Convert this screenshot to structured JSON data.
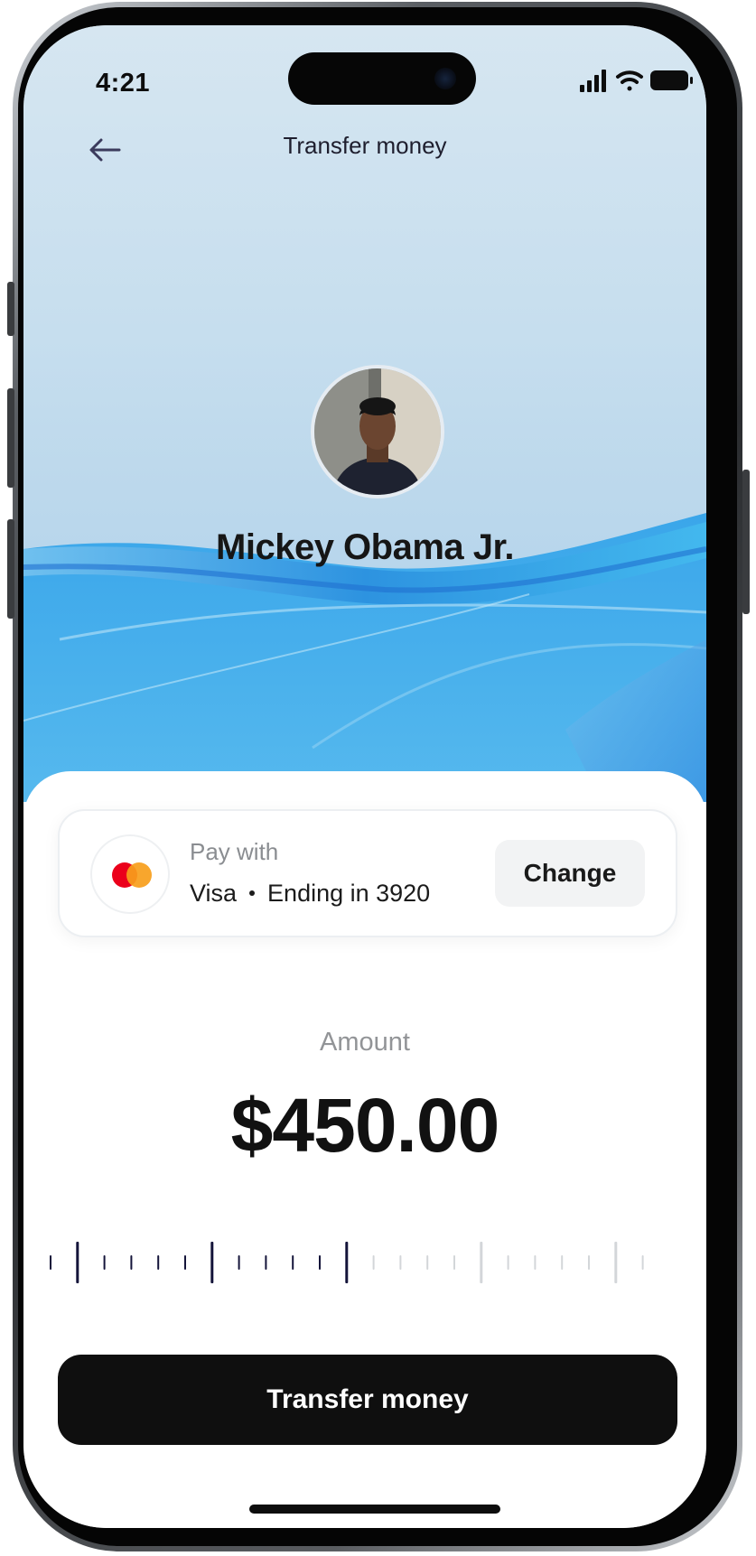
{
  "status_bar": {
    "time": "4:21",
    "icons": [
      "signal-bars-icon",
      "wifi-icon",
      "battery-icon"
    ]
  },
  "header": {
    "back_icon": "arrow-left-icon",
    "title": "Transfer money"
  },
  "recipient": {
    "name": "Mickey Obama Jr."
  },
  "payment_method": {
    "label": "Pay with",
    "card_brand": "Visa",
    "card_ending": "Ending in 3920",
    "logo": "mastercard-logo-icon",
    "change_label": "Change"
  },
  "amount": {
    "label": "Amount",
    "value": "$450.00",
    "slider_ticks_total": 23,
    "slider_ticks_active": 12
  },
  "cta": {
    "label": "Transfer money"
  },
  "colors": {
    "primary_button": "#0f0f0f",
    "ruler_active": "#14143a",
    "ruler_inactive": "#d3d6d9",
    "mastercard_red": "#eb001b",
    "mastercard_orange": "#f79e1b",
    "wave_blue": "#2f9be8"
  }
}
